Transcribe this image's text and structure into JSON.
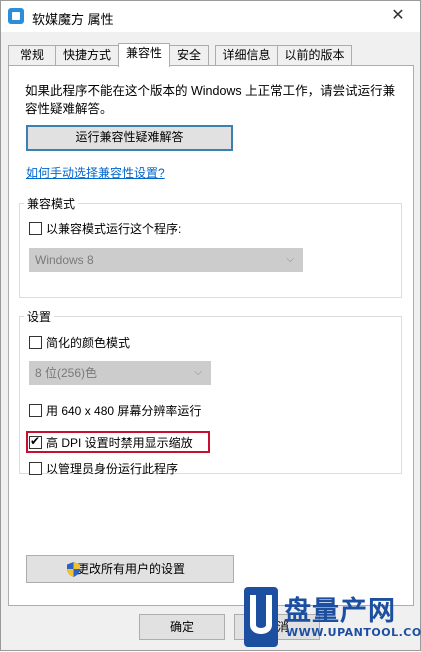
{
  "window": {
    "title": "软媒魔方 属性",
    "close_glyph": "✕"
  },
  "tabs": [
    {
      "label": "常规",
      "active": false
    },
    {
      "label": "快捷方式",
      "active": false
    },
    {
      "label": "兼容性",
      "active": true
    },
    {
      "label": "安全",
      "active": false
    },
    {
      "label": "详细信息",
      "active": false
    },
    {
      "label": "以前的版本",
      "active": false
    }
  ],
  "compat": {
    "intro_text": "如果此程序不能在这个版本的 Windows 上正常工作，请尝试运行兼容性疑难解答。",
    "troubleshoot_label": "运行兼容性疑难解答",
    "manual_link": "如何手动选择兼容性设置?",
    "mode_group": {
      "title": "兼容模式",
      "checkbox_label": "以兼容模式运行这个程序:",
      "checked": false,
      "os_selected": "Windows 8",
      "disabled": true
    },
    "settings_group": {
      "title": "设置",
      "reduced_color": {
        "label": "简化的颜色模式",
        "checked": false
      },
      "color_depth": "8 位(256)色",
      "res_640": {
        "label": "用 640 x 480 屏幕分辨率运行",
        "checked": false
      },
      "dpi_scaling": {
        "label": "高 DPI 设置时禁用显示缩放",
        "checked": true,
        "highlighted": true
      },
      "run_admin": {
        "label": "以管理员身份运行此程序",
        "checked": false
      }
    },
    "change_all_label": "更改所有用户的设置"
  },
  "footer": {
    "ok_label": "确定",
    "cancel_label": "取消"
  },
  "watermark": {
    "brand_cn": "盘量产网",
    "url": "WWW.UPANTOOL.COM"
  },
  "colors": {
    "accent_border": "#3c7fb1",
    "link": "#0066cc",
    "highlight_box": "#c8102e",
    "watermark_blue": "#1c4fa0"
  }
}
